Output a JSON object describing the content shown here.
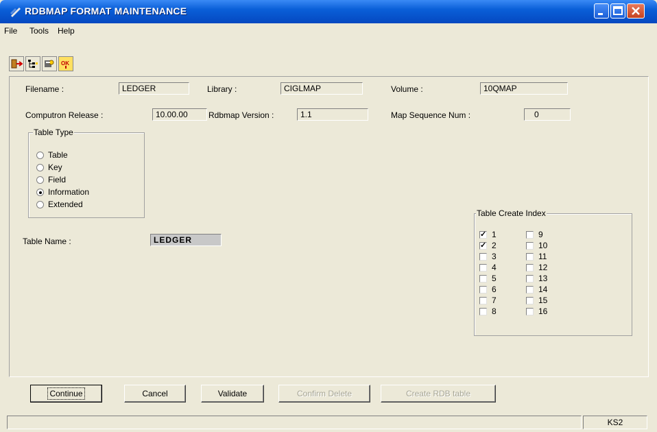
{
  "window": {
    "title": "RDBMAP FORMAT MAINTENANCE"
  },
  "menu": [
    "File",
    "Tools",
    "Help"
  ],
  "toolbar": {
    "icons": [
      "exit-icon",
      "tree-icon",
      "settings-icon",
      "ok-icon"
    ],
    "ok_glyph": "OK"
  },
  "form": {
    "filename_label": "Filename :",
    "filename_value": "LEDGER",
    "library_label": "Library :",
    "library_value": "CIGLMAP",
    "volume_label": "Volume :",
    "volume_value": "10QMAP",
    "release_label": "Computron Release :",
    "release_value": "10.00.00",
    "rdbmap_version_label": "Rdbmap Version :",
    "rdbmap_version_value": "1.1",
    "map_seq_label": "Map Sequence Num :",
    "map_seq_value": "0",
    "table_name_label": "Table Name :",
    "table_name_value": "LEDGER"
  },
  "table_type": {
    "title": "Table Type",
    "options": [
      "Table",
      "Key",
      "Field",
      "Information",
      "Extended"
    ],
    "selected": "Information"
  },
  "table_create_index": {
    "title": "Table Create Index",
    "items": [
      {
        "label": "1",
        "checked": true
      },
      {
        "label": "2",
        "checked": true
      },
      {
        "label": "3",
        "checked": false
      },
      {
        "label": "4",
        "checked": false
      },
      {
        "label": "5",
        "checked": false
      },
      {
        "label": "6",
        "checked": false
      },
      {
        "label": "7",
        "checked": false
      },
      {
        "label": "8",
        "checked": false
      },
      {
        "label": "9",
        "checked": false
      },
      {
        "label": "10",
        "checked": false
      },
      {
        "label": "11",
        "checked": false
      },
      {
        "label": "12",
        "checked": false
      },
      {
        "label": "13",
        "checked": false
      },
      {
        "label": "14",
        "checked": false
      },
      {
        "label": "15",
        "checked": false
      },
      {
        "label": "16",
        "checked": false
      }
    ]
  },
  "buttons": {
    "continue": "Continue",
    "cancel": "Cancel",
    "validate": "Validate",
    "confirm_delete": "Confirm Delete",
    "create_rdb": "Create RDB table"
  },
  "status": {
    "right": "KS2"
  },
  "colors": {
    "titlebar": "#0a5fd8",
    "face": "#ece9d8",
    "disabled_text": "#a7a696"
  }
}
